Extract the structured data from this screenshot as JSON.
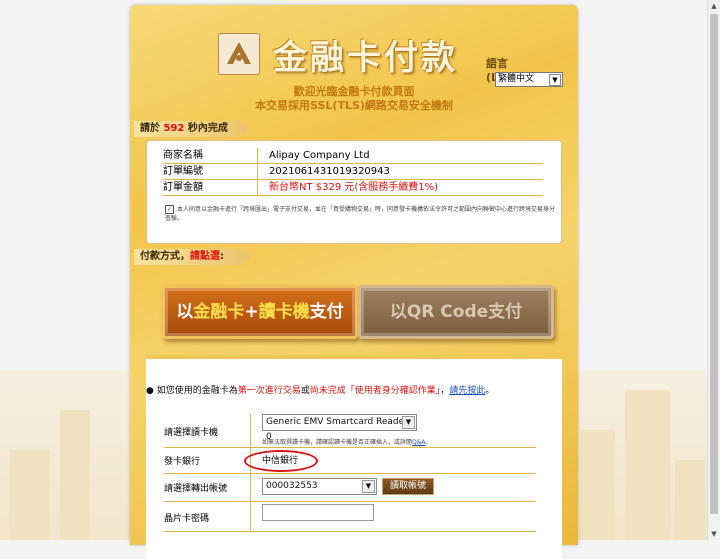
{
  "header": {
    "title": "金融卡付款",
    "language_label": "語言(Language)",
    "language_value": "繁體中文",
    "welcome_line1": "歡迎光臨金融卡付款頁面",
    "welcome_line2": "本交易採用SSL(TLS)網路交易安全機制"
  },
  "timer": {
    "prefix": "請於",
    "seconds": "592",
    "suffix": "秒內完成"
  },
  "order": {
    "rows": [
      {
        "label": "商家名稱",
        "value": "Alipay Company Ltd"
      },
      {
        "label": "訂單編號",
        "value": "2021061431019320943"
      },
      {
        "label": "訂單金額",
        "value": "新台幣NT $329 元(含服務手續費1%)"
      }
    ],
    "agreement": "本人同意以金融卡進行「跨境匯出」電子支付交易，並在「買受購物交易」時，同意發卡機構依法令許可之範圍內向聯徵中心進行跨境交易身分查驗。"
  },
  "payment_method": {
    "label": "付款方式，",
    "highlight": "請點選",
    "colon": ":"
  },
  "buttons": {
    "card_reader": {
      "pre": "以",
      "hl1": "金融卡",
      "mid": "+",
      "hl2": "讀卡機",
      "post": "支付"
    },
    "qr": {
      "pre": "以",
      "hl": "QR Code",
      "post": "支付"
    }
  },
  "notice": {
    "part1": "如您使用的金融卡為",
    "red1": "第一次進行交易",
    "part2": "或",
    "red2": "尚未完成「使用者身分確認作業」",
    "part3": "，",
    "link": "請先按此",
    "part4": "。"
  },
  "form": {
    "reader_label": "請選擇讀卡機",
    "reader_value": "Generic EMV Smartcard Reader 0",
    "reader_note": "如無法取得讀卡機，請確認讀卡機是否正確插入，或詳閱",
    "reader_note_link": "Q&A",
    "reader_note_end": "。",
    "bank_label": "發卡銀行",
    "bank_value": "中信銀行",
    "account_label": "請選擇轉出帳號",
    "account_value": "000032553",
    "read_button": "讀取帳號",
    "pin_label": "晶片卡密碼"
  },
  "colors": {
    "accent": "#d11111",
    "gold": "#f2c54a",
    "link": "#1a4fbf"
  }
}
